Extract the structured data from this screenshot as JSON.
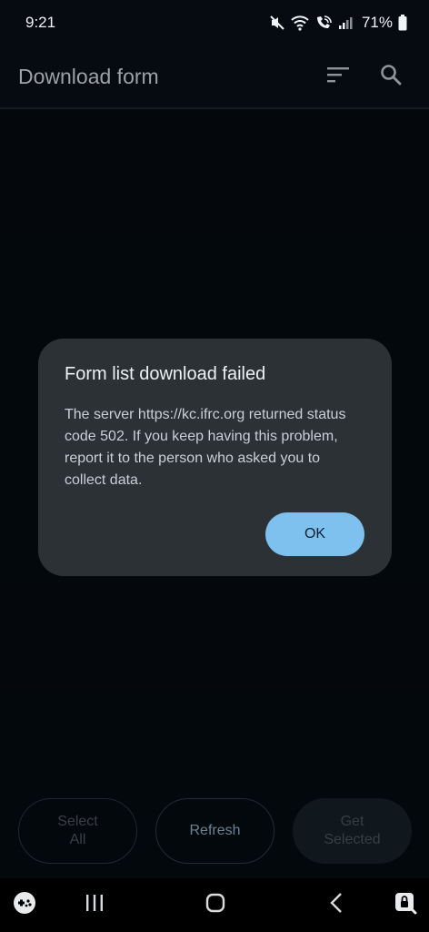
{
  "status_bar": {
    "time": "9:21",
    "battery": "71%",
    "icons": [
      "mute-icon",
      "wifi-icon",
      "wifi-call-icon",
      "signal-icon",
      "battery-icon"
    ]
  },
  "app_bar": {
    "title": "Download form",
    "actions": [
      "sort-icon",
      "search-icon"
    ]
  },
  "dialog": {
    "title": "Form list download failed",
    "message": "The server https://kc.ifrc.org returned status code 502. If you keep having this problem, report it to the person who asked you to collect data.",
    "ok_label": "OK"
  },
  "bottom_buttons": {
    "select_all": "Select All",
    "refresh": "Refresh",
    "get_selected": "Get Selected"
  },
  "nav_bar": {
    "icons": [
      "game-launcher-icon",
      "recents-icon",
      "home-icon",
      "back-icon",
      "secure-folder-icon"
    ]
  },
  "colors": {
    "background": "#050b10",
    "dialog": "#2b3135",
    "accent": "#7ec0ee"
  }
}
